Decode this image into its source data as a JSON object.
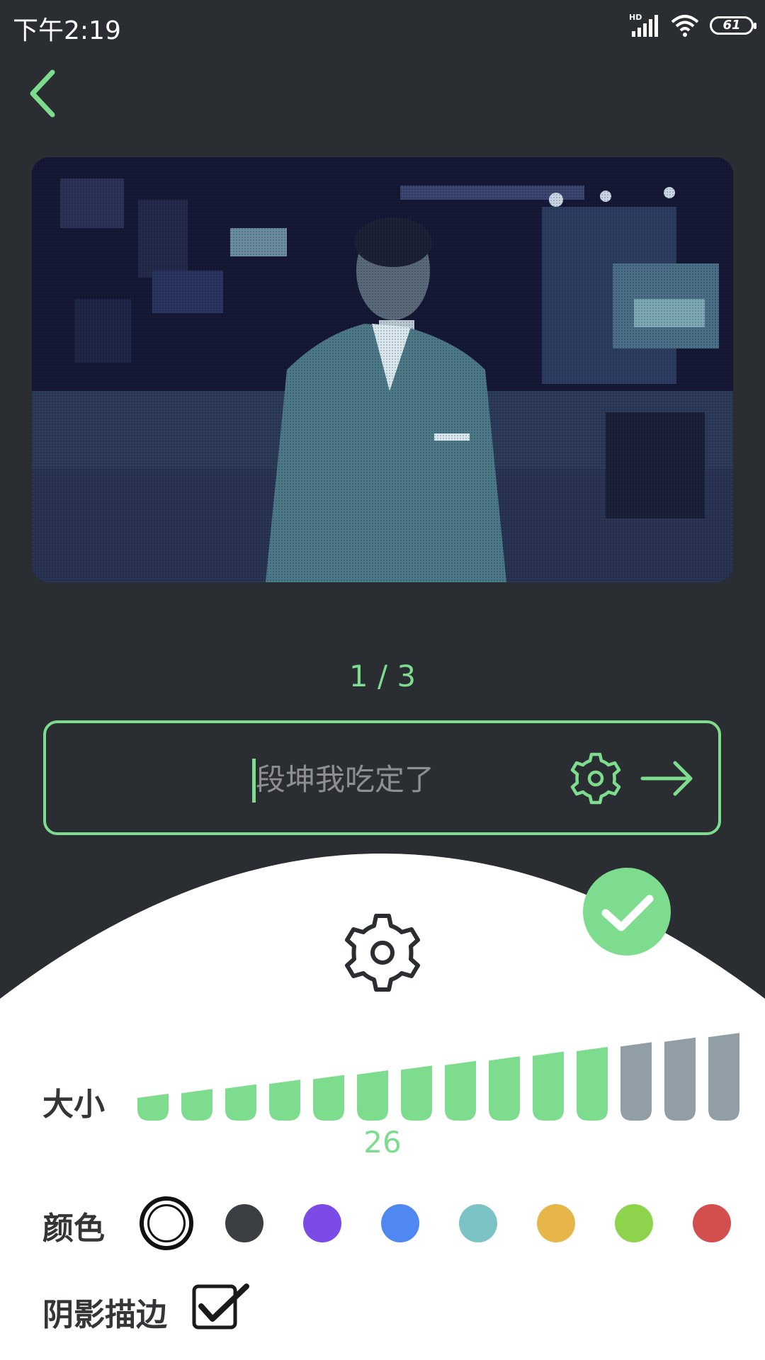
{
  "status_bar": {
    "time": "下午2:19",
    "network_label": "HD",
    "battery_level": "61",
    "icons": [
      "signal-icon",
      "wifi-icon",
      "battery-icon"
    ]
  },
  "nav": {
    "back_icon": "chevron-left-icon"
  },
  "preview": {
    "page_indicator": "1 / 3"
  },
  "input": {
    "placeholder": "段坤我吃定了",
    "icons": [
      "gear-icon",
      "arrow-right-icon"
    ]
  },
  "sheet": {
    "confirm_icon": "check-icon",
    "settings_icon": "gear-icon",
    "size": {
      "label": "大小",
      "value": "26",
      "steps_total": 14,
      "steps_active": 11
    },
    "color": {
      "label": "颜色",
      "options": [
        "#ffffff",
        "#3b3e42",
        "#7c4ae6",
        "#4f88f0",
        "#7cc3c5",
        "#e6b64a",
        "#8dd34c",
        "#d24f4d"
      ],
      "selected_index": 0
    },
    "shadow": {
      "label": "阴影描边",
      "checked": true
    }
  },
  "colors": {
    "background": "#2a2d31",
    "accent": "#7ddc8d",
    "inactive_bar": "#929ea6",
    "sheet": "#ffffff"
  }
}
